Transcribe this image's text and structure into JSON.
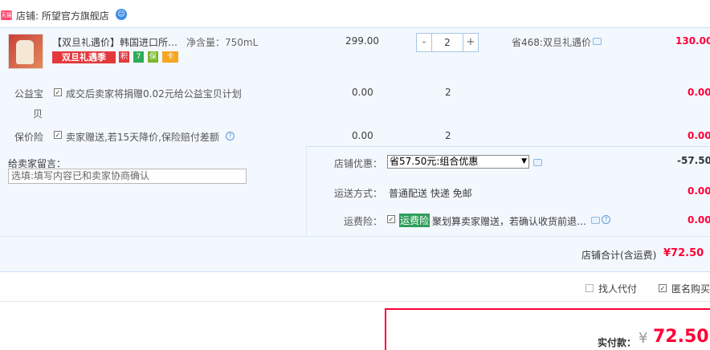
{
  "shop": {
    "badge": "天猫",
    "label": "店铺: 所望官方旗舰店",
    "ww_icon": "wangwang-chat-icon"
  },
  "item": {
    "title": "【双旦礼遇价】韩国进口所…",
    "spec": "净含量：750mL",
    "promo": "双旦礼遇季",
    "badges": [
      "积",
      "7",
      "保",
      "卡"
    ],
    "price": "299.00",
    "qty": "2",
    "qty_minus": "-",
    "qty_plus": "+",
    "saving": "省468:双旦礼遇价",
    "subtotal": "130.00"
  },
  "services": [
    {
      "label_line1": "公益宝",
      "label_line2": "贝",
      "desc": "成交后卖家将捐赠0.02元给公益宝贝计划",
      "price": "0.00",
      "qty": "2",
      "subtotal": "0.00"
    },
    {
      "label_line1": "保价险",
      "desc": "卖家赠送,若15天降价,保险赔付差额",
      "price": "0.00",
      "qty": "2",
      "subtotal": "0.00"
    }
  ],
  "message": {
    "label": "给卖家留言：",
    "placeholder": "选填:填写内容已和卖家协商确认"
  },
  "discount": {
    "label": "店铺优惠：",
    "selected": "省57.50元:组合优惠",
    "amount": "-57.50"
  },
  "shipping": {
    "label": "运送方式：",
    "value": "普通配送 快递 免邮",
    "amount": "0.00"
  },
  "insurance": {
    "label": "运费险：",
    "tag": "运费险",
    "desc": "聚划算卖家赠送，若确认收货前退…",
    "amount": "0.00"
  },
  "shop_total": {
    "label": "店铺合计(含运费)",
    "value": "¥72.50"
  },
  "options": {
    "proxy_pay": "找人代付",
    "anonymous": "匿名购买"
  },
  "actual_pay": {
    "label": "实付款：",
    "currency": "¥",
    "value": "72.50"
  },
  "colors": {
    "accent_red": "#ff0036",
    "panel_bg": "#f3f8ff",
    "border_blue": "#cce0f5"
  }
}
